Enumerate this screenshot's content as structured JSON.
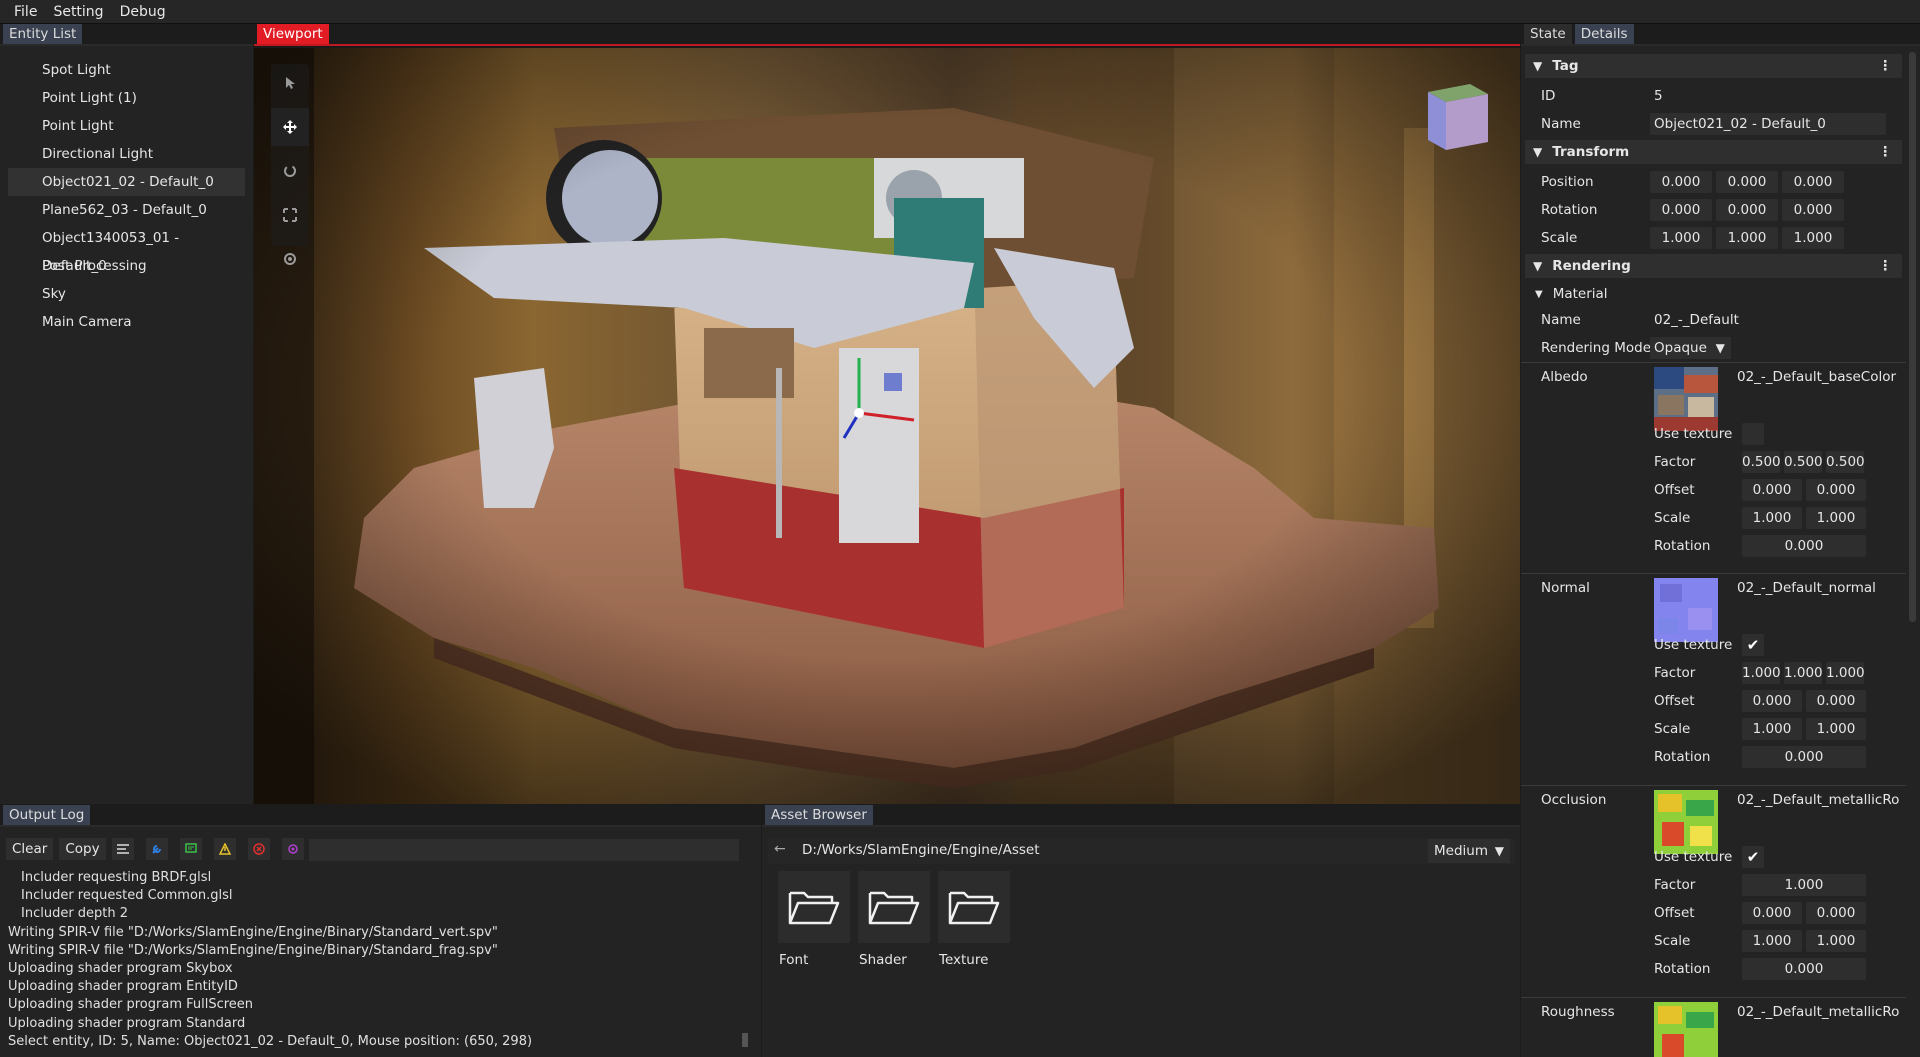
{
  "menu": [
    "File",
    "Setting",
    "Debug"
  ],
  "entity_panel": {
    "tab": "Entity List",
    "items": [
      {
        "label": "Spot Light"
      },
      {
        "label": "Point Light (1)"
      },
      {
        "label": "Point Light"
      },
      {
        "label": "Directional Light"
      },
      {
        "label": "Object021_02 - Default_0",
        "selected": true
      },
      {
        "label": "Plane562_03 - Default_0"
      },
      {
        "label": "Object1340053_01 - Default_0"
      },
      {
        "label": "Post Processing"
      },
      {
        "label": "Sky"
      },
      {
        "label": "Main Camera"
      }
    ]
  },
  "viewport": {
    "tab": "Viewport",
    "tools": [
      "select-icon",
      "move-icon",
      "rotate-icon",
      "scale-icon",
      "universal-icon"
    ]
  },
  "right_panel": {
    "tabs": [
      "State",
      "Details"
    ],
    "tag": {
      "header": "Tag",
      "id_label": "ID",
      "id_value": "5",
      "name_label": "Name",
      "name_value": "Object021_02 - Default_0"
    },
    "transform": {
      "header": "Transform",
      "rows": [
        {
          "label": "Position",
          "values": [
            "0.000",
            "0.000",
            "0.000"
          ]
        },
        {
          "label": "Rotation",
          "values": [
            "0.000",
            "0.000",
            "0.000"
          ]
        },
        {
          "label": "Scale",
          "values": [
            "1.000",
            "1.000",
            "1.000"
          ]
        }
      ]
    },
    "rendering": {
      "header": "Rendering",
      "material_header": "Material",
      "name_label": "Name",
      "name_value": "02_-_Default",
      "mode_label": "Rendering Mode",
      "mode_value": "Opaque",
      "textures": [
        {
          "label": "Albedo",
          "texture_name": "02_-_Default_baseColor",
          "use_label": "Use texture",
          "use_checked": false,
          "factor_label": "Factor",
          "factor": [
            "0.500",
            "0.500",
            "0.500"
          ],
          "offset_label": "Offset",
          "offset": [
            "0.000",
            "0.000"
          ],
          "scale_label": "Scale",
          "scale": [
            "1.000",
            "1.000"
          ],
          "rotation_label": "Rotation",
          "rotation": "0.000"
        },
        {
          "label": "Normal",
          "texture_name": "02_-_Default_normal",
          "use_label": "Use texture",
          "use_checked": true,
          "factor_label": "Factor",
          "factor": [
            "1.000",
            "1.000",
            "1.000"
          ],
          "offset_label": "Offset",
          "offset": [
            "0.000",
            "0.000"
          ],
          "scale_label": "Scale",
          "scale": [
            "1.000",
            "1.000"
          ],
          "rotation_label": "Rotation",
          "rotation": "0.000"
        },
        {
          "label": "Occlusion",
          "texture_name": "02_-_Default_metallicRo",
          "use_label": "Use texture",
          "use_checked": true,
          "factor_label": "Factor",
          "factor": [
            "1.000"
          ],
          "offset_label": "Offset",
          "offset": [
            "0.000",
            "0.000"
          ],
          "scale_label": "Scale",
          "scale": [
            "1.000",
            "1.000"
          ],
          "rotation_label": "Rotation",
          "rotation": "0.000"
        },
        {
          "label": "Roughness",
          "texture_name": "02_-_Default_metallicRo"
        }
      ]
    }
  },
  "output_log": {
    "tab": "Output Log",
    "clear_label": "Clear",
    "copy_label": "Copy",
    "lines": [
      {
        "text": "Includer requesting BRDF.glsl",
        "indent": true
      },
      {
        "text": "Includer requested Common.glsl",
        "indent": true
      },
      {
        "text": "Includer depth 2",
        "indent": true
      },
      {
        "text": "Writing SPIR-V file \"D:/Works/SlamEngine/Engine/Binary/Standard_vert.spv\"",
        "indent": false
      },
      {
        "text": "Writing SPIR-V file \"D:/Works/SlamEngine/Engine/Binary/Standard_frag.spv\"",
        "indent": false
      },
      {
        "text": "Uploading shader program Skybox",
        "indent": false
      },
      {
        "text": "Uploading shader program EntityID",
        "indent": false
      },
      {
        "text": "Uploading shader program FullScreen",
        "indent": false
      },
      {
        "text": "Uploading shader program Standard",
        "indent": false
      },
      {
        "text": "Select entity, ID: 5, Name: Object021_02 - Default_0, Mouse position: (650, 298)",
        "indent": false
      }
    ]
  },
  "asset_browser": {
    "tab": "Asset Browser",
    "path": "D:/Works/SlamEngine/Engine/Asset",
    "size": "Medium",
    "folders": [
      "Font",
      "Shader",
      "Texture"
    ]
  },
  "colors": {
    "accent_red": "#e21c24",
    "details_tab": "#3a4150",
    "panel": "#232323"
  }
}
